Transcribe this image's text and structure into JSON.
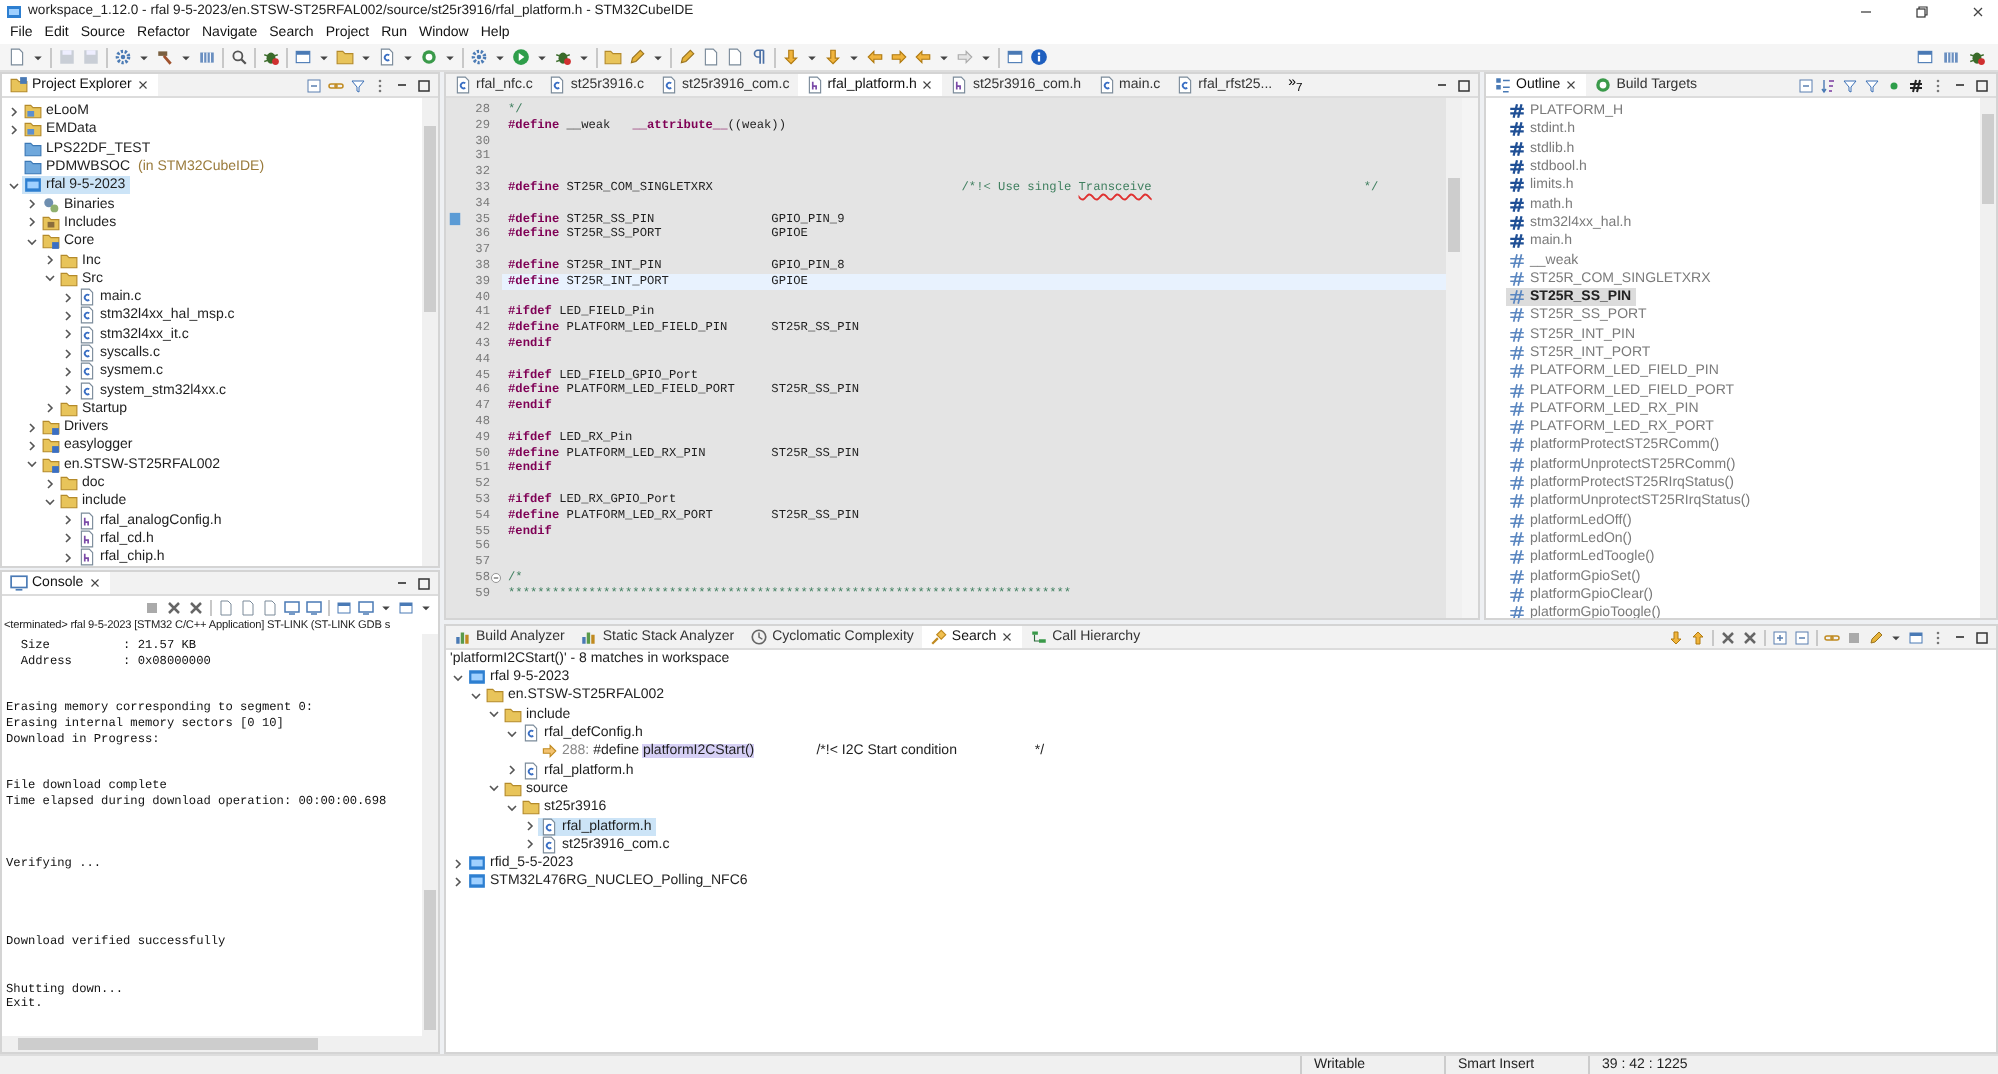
{
  "window": {
    "title": "workspace_1.12.0 - rfal 9-5-2023/en.STSW-ST25RFAL002/source/st25r3916/rfal_platform.h - STM32CubeIDE"
  },
  "menu": [
    "File",
    "Edit",
    "Source",
    "Refactor",
    "Navigate",
    "Search",
    "Project",
    "Run",
    "Window",
    "Help"
  ],
  "project_explorer": {
    "tab": "Project Explorer",
    "items": [
      {
        "label": "eLooM",
        "kind": "project-folder",
        "expanded": false,
        "selected": false
      },
      {
        "label": "EMData",
        "kind": "project-folder",
        "expanded": false,
        "selected": false
      },
      {
        "label": "LPS22DF_TEST",
        "kind": "closed-project",
        "selected": false
      },
      {
        "label": "PDMWBSOC",
        "suffix": "(in STM32CubeIDE)",
        "kind": "closed-project",
        "selected": false
      },
      {
        "label": "rfal 9-5-2023",
        "kind": "project",
        "expanded": true,
        "selected": true,
        "children": [
          {
            "label": "Binaries",
            "kind": "binaries",
            "expanded": false,
            "selected": false
          },
          {
            "label": "Includes",
            "kind": "includes",
            "expanded": false,
            "selected": false
          },
          {
            "label": "Core",
            "kind": "source-folder",
            "expanded": true,
            "selected": false,
            "children": [
              {
                "label": "Inc",
                "kind": "folder",
                "expanded": false,
                "selected": false
              },
              {
                "label": "Src",
                "kind": "folder",
                "expanded": true,
                "selected": false,
                "children": [
                  {
                    "label": "main.c",
                    "kind": "c-file",
                    "expanded": false,
                    "selected": false
                  },
                  {
                    "label": "stm32l4xx_hal_msp.c",
                    "kind": "c-file",
                    "expanded": false,
                    "selected": false
                  },
                  {
                    "label": "stm32l4xx_it.c",
                    "kind": "c-file",
                    "expanded": false,
                    "selected": false
                  },
                  {
                    "label": "syscalls.c",
                    "kind": "c-file",
                    "expanded": false,
                    "selected": false
                  },
                  {
                    "label": "sysmem.c",
                    "kind": "c-file",
                    "expanded": false,
                    "selected": false
                  },
                  {
                    "label": "system_stm32l4xx.c",
                    "kind": "c-file",
                    "expanded": false,
                    "selected": false
                  }
                ]
              },
              {
                "label": "Startup",
                "kind": "folder",
                "expanded": false,
                "selected": false
              }
            ]
          },
          {
            "label": "Drivers",
            "kind": "source-folder",
            "expanded": false,
            "selected": false
          },
          {
            "label": "easylogger",
            "kind": "source-folder",
            "expanded": false,
            "selected": false
          },
          {
            "label": "en.STSW-ST25RFAL002",
            "kind": "source-folder",
            "expanded": true,
            "selected": false,
            "children": [
              {
                "label": "doc",
                "kind": "folder",
                "expanded": false,
                "selected": false
              },
              {
                "label": "include",
                "kind": "folder",
                "expanded": true,
                "selected": false,
                "children": [
                  {
                    "label": "rfal_analogConfig.h",
                    "kind": "h-file",
                    "expanded": false,
                    "selected": false
                  },
                  {
                    "label": "rfal_cd.h",
                    "kind": "h-file",
                    "expanded": false,
                    "selected": false
                  },
                  {
                    "label": "rfal_chip.h",
                    "kind": "h-file",
                    "expanded": false,
                    "selected": false
                  }
                ]
              }
            ]
          }
        ]
      }
    ]
  },
  "console": {
    "tab": "Console",
    "status": "<terminated> rfal 9-5-2023 [STM32 C/C++ Application] ST-LINK (ST-LINK GDB s",
    "output": "  Size          : 21.57 KB\n  Address       : 0x08000000\n\n\nErasing memory corresponding to segment 0:\nErasing internal memory sectors [0 10]\nDownload in Progress:\n\n\nFile download complete\nTime elapsed during download operation: 00:00:00.698\n\n\n\nVerifying ...\n\n\n\n\nDownload verified successfully\n\n\nShutting down...\nExit."
  },
  "editor": {
    "tabs": [
      {
        "label": "rfal_nfc.c",
        "kind": "c",
        "selected": false
      },
      {
        "label": "st25r3916.c",
        "kind": "c",
        "selected": false
      },
      {
        "label": "st25r3916_com.c",
        "kind": "c",
        "selected": false
      },
      {
        "label": "rfal_platform.h",
        "kind": "h",
        "selected": true
      },
      {
        "label": "st25r3916_com.h",
        "kind": "h",
        "selected": false
      },
      {
        "label": "main.c",
        "kind": "c",
        "selected": false
      },
      {
        "label": "rfal_rfst25...",
        "kind": "c",
        "selected": false
      }
    ],
    "overflow": "»$_{7}$",
    "lines": [
      {
        "number": "28",
        "current": false,
        "parts": [
          {
            "kind": "comment",
            "text": "*/"
          }
        ]
      },
      {
        "number": "29",
        "current": false,
        "parts": [
          {
            "kind": "directive",
            "text": "#define"
          },
          {
            "kind": "plain",
            "text": " __weak   "
          },
          {
            "kind": "keyword",
            "text": "__attribute__"
          },
          {
            "kind": "plain",
            "text": "((weak))"
          }
        ]
      },
      {
        "number": "30",
        "current": false
      },
      {
        "number": "31",
        "current": false
      },
      {
        "number": "32",
        "current": false
      },
      {
        "number": "33",
        "current": false,
        "parts": [
          {
            "kind": "directive",
            "text": "#define"
          },
          {
            "kind": "plain",
            "text": " ST25R_COM_SINGLETXRX                                  "
          },
          {
            "kind": "comment",
            "text": "/*!< Use single "
          },
          {
            "kind": "misspelled-comment",
            "text": "Transceive"
          },
          {
            "kind": "comment",
            "text": "                             */"
          }
        ]
      },
      {
        "number": "34",
        "current": false
      },
      {
        "number": "35",
        "current": false,
        "kind": "bookmarked",
        "parts": [
          {
            "kind": "directive",
            "text": "#define"
          },
          {
            "kind": "plain",
            "text": " ST25R_SS_PIN                GPIO_PIN_9"
          }
        ]
      },
      {
        "number": "36",
        "current": false,
        "parts": [
          {
            "kind": "directive",
            "text": "#define"
          },
          {
            "kind": "plain",
            "text": " ST25R_SS_PORT               GPIOE"
          }
        ]
      },
      {
        "number": "37",
        "current": false
      },
      {
        "number": "38",
        "current": false,
        "parts": [
          {
            "kind": "directive",
            "text": "#define"
          },
          {
            "kind": "plain",
            "text": " ST25R_INT_PIN               GPIO_PIN_8"
          }
        ]
      },
      {
        "number": "39",
        "current": true,
        "parts": [
          {
            "kind": "directive",
            "text": "#define"
          },
          {
            "kind": "plain",
            "text": " ST25R_INT_PORT              GPIOE"
          }
        ]
      },
      {
        "number": "40",
        "current": false
      },
      {
        "number": "41",
        "current": false,
        "parts": [
          {
            "kind": "directive",
            "text": "#ifdef"
          },
          {
            "kind": "plain",
            "text": " LED_FIELD_Pin"
          }
        ]
      },
      {
        "number": "42",
        "current": false,
        "parts": [
          {
            "kind": "directive",
            "text": "#define"
          },
          {
            "kind": "plain",
            "text": " PLATFORM_LED_FIELD_PIN      ST25R_SS_PIN"
          }
        ]
      },
      {
        "number": "43",
        "current": false,
        "parts": [
          {
            "kind": "directive",
            "text": "#endif"
          }
        ]
      },
      {
        "number": "44",
        "current": false
      },
      {
        "number": "45",
        "current": false,
        "parts": [
          {
            "kind": "directive",
            "text": "#ifdef"
          },
          {
            "kind": "plain",
            "text": " LED_FIELD_GPIO_Port"
          }
        ]
      },
      {
        "number": "46",
        "current": false,
        "parts": [
          {
            "kind": "directive",
            "text": "#define"
          },
          {
            "kind": "plain",
            "text": " PLATFORM_LED_FIELD_PORT     ST25R_SS_PIN"
          }
        ]
      },
      {
        "number": "47",
        "current": false,
        "parts": [
          {
            "kind": "directive",
            "text": "#endif"
          }
        ]
      },
      {
        "number": "48",
        "current": false
      },
      {
        "number": "49",
        "current": false,
        "parts": [
          {
            "kind": "directive",
            "text": "#ifdef"
          },
          {
            "kind": "plain",
            "text": " LED_RX_Pin"
          }
        ]
      },
      {
        "number": "50",
        "current": false,
        "parts": [
          {
            "kind": "directive",
            "text": "#define"
          },
          {
            "kind": "plain",
            "text": " PLATFORM_LED_RX_PIN         ST25R_SS_PIN"
          }
        ]
      },
      {
        "number": "51",
        "current": false,
        "parts": [
          {
            "kind": "directive",
            "text": "#endif"
          }
        ]
      },
      {
        "number": "52",
        "current": false
      },
      {
        "number": "53",
        "current": false,
        "parts": [
          {
            "kind": "directive",
            "text": "#ifdef"
          },
          {
            "kind": "plain",
            "text": " LED_RX_GPIO_Port"
          }
        ]
      },
      {
        "number": "54",
        "current": false,
        "parts": [
          {
            "kind": "directive",
            "text": "#define"
          },
          {
            "kind": "plain",
            "text": " PLATFORM_LED_RX_PORT        ST25R_SS_PIN"
          }
        ]
      },
      {
        "number": "55",
        "current": false,
        "parts": [
          {
            "kind": "directive",
            "text": "#endif"
          }
        ]
      },
      {
        "number": "56",
        "current": false
      },
      {
        "number": "57",
        "current": false
      },
      {
        "number": "58",
        "current": false,
        "kind": "fold-start",
        "parts": [
          {
            "kind": "comment",
            "text": "/*"
          }
        ]
      },
      {
        "number": "59",
        "current": false,
        "parts": [
          {
            "kind": "comment",
            "text": "*****************************************************************************"
          }
        ]
      }
    ]
  },
  "outline": {
    "tabs": [
      {
        "label": "Outline",
        "selected": true
      },
      {
        "label": "Build Targets",
        "selected": false
      }
    ],
    "items": [
      {
        "label": "PLATFORM_H",
        "kind": "include",
        "selected": false
      },
      {
        "label": "stdint.h",
        "kind": "include",
        "selected": false
      },
      {
        "label": "stdlib.h",
        "kind": "include",
        "selected": false
      },
      {
        "label": "stdbool.h",
        "kind": "include",
        "selected": false
      },
      {
        "label": "limits.h",
        "kind": "include",
        "selected": false
      },
      {
        "label": "math.h",
        "kind": "include",
        "selected": false
      },
      {
        "label": "stm32l4xx_hal.h",
        "kind": "include",
        "selected": false
      },
      {
        "label": "main.h",
        "kind": "include",
        "selected": false
      },
      {
        "label": "__weak",
        "kind": "macro",
        "selected": false
      },
      {
        "label": "ST25R_COM_SINGLETXRX",
        "kind": "macro",
        "selected": false
      },
      {
        "label": "ST25R_SS_PIN",
        "kind": "macro",
        "selected": true
      },
      {
        "label": "ST25R_SS_PORT",
        "kind": "macro",
        "selected": false
      },
      {
        "label": "ST25R_INT_PIN",
        "kind": "macro",
        "selected": false
      },
      {
        "label": "ST25R_INT_PORT",
        "kind": "macro",
        "selected": false
      },
      {
        "label": "PLATFORM_LED_FIELD_PIN",
        "kind": "macro",
        "selected": false
      },
      {
        "label": "PLATFORM_LED_FIELD_PORT",
        "kind": "macro",
        "selected": false
      },
      {
        "label": "PLATFORM_LED_RX_PIN",
        "kind": "macro",
        "selected": false
      },
      {
        "label": "PLATFORM_LED_RX_PORT",
        "kind": "macro",
        "selected": false
      },
      {
        "label": "platformProtectST25RComm()",
        "kind": "macro",
        "selected": false
      },
      {
        "label": "platformUnprotectST25RComm()",
        "kind": "macro",
        "selected": false
      },
      {
        "label": "platformProtectST25RIrqStatus()",
        "kind": "macro",
        "selected": false
      },
      {
        "label": "platformUnprotectST25RIrqStatus()",
        "kind": "macro",
        "selected": false
      },
      {
        "label": "platformLedOff()",
        "kind": "macro",
        "selected": false
      },
      {
        "label": "platformLedOn()",
        "kind": "macro",
        "selected": false
      },
      {
        "label": "platformLedToogle()",
        "kind": "macro",
        "selected": false
      },
      {
        "label": "platformGpioSet()",
        "kind": "macro",
        "selected": false
      },
      {
        "label": "platformGpioClear()",
        "kind": "macro",
        "selected": false
      },
      {
        "label": "platformGpioToogle()",
        "kind": "macro",
        "selected": false
      }
    ]
  },
  "search": {
    "tabs": [
      {
        "label": "Build Analyzer",
        "selected": false
      },
      {
        "label": "Static Stack Analyzer",
        "selected": false
      },
      {
        "label": "Cyclomatic Complexity",
        "selected": false
      },
      {
        "label": "Search",
        "selected": true
      },
      {
        "label": "Call Hierarchy",
        "selected": false
      }
    ],
    "summary": "'platformI2CStart()' - 8 matches in workspace",
    "results": [
      {
        "label": "rfal 9-5-2023",
        "kind": "project",
        "expanded": true,
        "selected": false,
        "children": [
          {
            "label": "en.STSW-ST25RFAL002",
            "kind": "folder",
            "expanded": true,
            "selected": false,
            "children": [
              {
                "label": "include",
                "kind": "folder",
                "expanded": true,
                "selected": false,
                "children": [
                  {
                    "label": "rfal_defConfig.h",
                    "kind": "c-file",
                    "expanded": true,
                    "selected": false,
                    "children": [
                      {
                        "kind": "match",
                        "selected": false,
                        "line_number": "288:",
                        "before": "#define ",
                        "match": "platformI2CStart()",
                        "after": "                /*!< I2C Start condition                    */"
                      }
                    ]
                  },
                  {
                    "label": "rfal_platform.h",
                    "kind": "c-file",
                    "expanded": false,
                    "selected": false
                  }
                ]
              },
              {
                "label": "source",
                "kind": "folder",
                "expanded": true,
                "selected": false,
                "children": [
                  {
                    "label": "st25r3916",
                    "kind": "folder",
                    "expanded": true,
                    "selected": false,
                    "children": [
                      {
                        "label": "rfal_platform.h",
                        "kind": "c-file",
                        "expanded": false,
                        "selected": true
                      },
                      {
                        "label": "st25r3916_com.c",
                        "kind": "c-file",
                        "expanded": false,
                        "selected": false
                      }
                    ]
                  }
                ]
              }
            ]
          }
        ]
      },
      {
        "label": "rfid_5-5-2023",
        "kind": "project",
        "expanded": false,
        "selected": false
      },
      {
        "label": "STM32L476RG_NUCLEO_Polling_NFC6",
        "kind": "project",
        "expanded": false,
        "selected": false
      }
    ]
  },
  "status_bar": [
    "Writable",
    "Smart Insert",
    "39 : 42 : 1225"
  ]
}
